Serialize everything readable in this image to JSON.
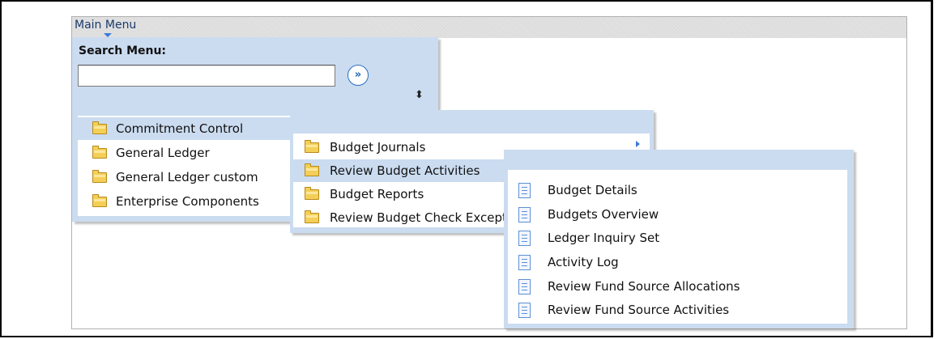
{
  "main_menu": {
    "label": "Main Menu"
  },
  "search": {
    "label": "Search Menu:",
    "value": "",
    "go_icon": "»"
  },
  "sort_icon": "⬍",
  "menu1": {
    "items": [
      {
        "label": "Commitment Control",
        "icon": "folder-icon",
        "selected": true
      },
      {
        "label": "General Ledger",
        "icon": "folder-icon"
      },
      {
        "label": "General Ledger custom",
        "icon": "folder-icon"
      },
      {
        "label": "Enterprise Components",
        "icon": "folder-icon"
      }
    ]
  },
  "menu2": {
    "items": [
      {
        "label": "Budget Journals",
        "icon": "folder-icon",
        "has_submenu": true
      },
      {
        "label": "Review Budget Activities",
        "icon": "folder-icon",
        "selected": true
      },
      {
        "label": "Budget Reports",
        "icon": "folder-icon"
      },
      {
        "label": "Review Budget Check Exceptions",
        "icon": "folder-icon"
      }
    ]
  },
  "menu3": {
    "items": [
      {
        "label": "Budget Details",
        "icon": "document-icon"
      },
      {
        "label": "Budgets Overview",
        "icon": "document-icon"
      },
      {
        "label": "Ledger Inquiry Set",
        "icon": "document-icon"
      },
      {
        "label": "Activity Log",
        "icon": "document-icon"
      },
      {
        "label": "Review Fund Source Allocations",
        "icon": "document-icon"
      },
      {
        "label": "Review Fund Source Activities",
        "icon": "document-icon"
      }
    ]
  },
  "colors": {
    "menu_bg": "#cbdcf0",
    "topbar_bg": "#e2e2e2",
    "link_blue": "#1d5fb8",
    "folder_yellow": "#f4cf57"
  }
}
